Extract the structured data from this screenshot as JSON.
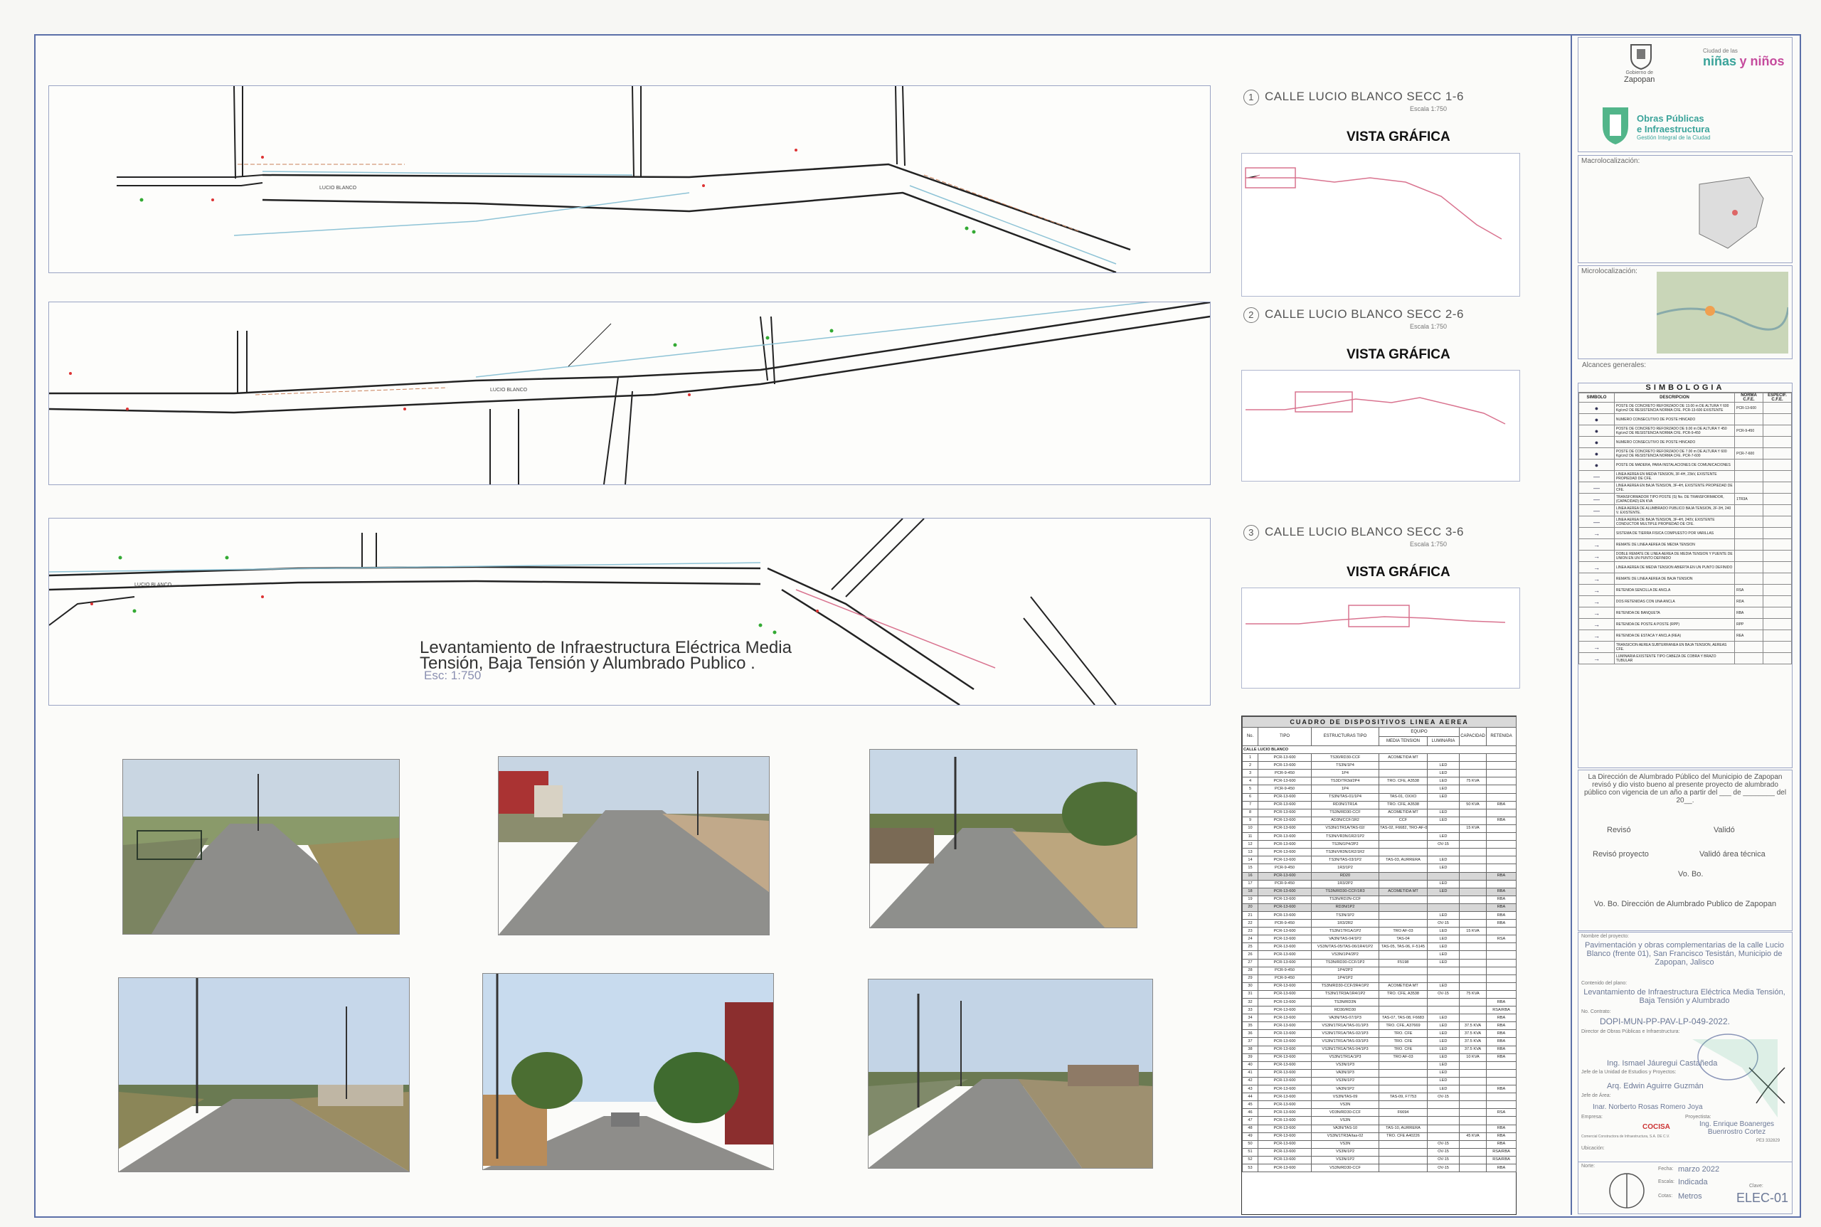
{
  "sections": [
    {
      "num": "1",
      "title": "CALLE LUCIO BLANCO SECC 1-6",
      "scale": "Escala 1:750",
      "vista": "VISTA GRÁFICA",
      "street": "LUCIO BLANCO"
    },
    {
      "num": "2",
      "title": "CALLE LUCIO BLANCO SECC 2-6",
      "scale": "Escala 1:750",
      "vista": "VISTA GRÁFICA",
      "street": "LUCIO BLANCO"
    },
    {
      "num": "3",
      "title": "CALLE LUCIO BLANCO SECC 3-6",
      "scale": "Escala 1:750",
      "vista": "VISTA GRÁFICA",
      "street": "LUCIO BLANCO"
    }
  ],
  "main_title": {
    "line1": "Levantamiento de Infraestructura Eléctrica Media",
    "line2": "Tensión, Baja Tensión y Alumbrado Publico .",
    "scale": "Esc: 1:750"
  },
  "cuadro": {
    "title": "CUADRO DE DISPOSITIVOS LINEA AEREA",
    "headers": {
      "no": "No.",
      "tipo": "TIPO",
      "estructuras": "ESTRUCTURAS TIPO",
      "equipo": "EQUIPO",
      "media": "MEDIA TENSION",
      "luminaria": "LUMINARIA",
      "capacidad": "CAPACIDAD",
      "retenida": "RETENIDA"
    },
    "group": "CALLE LUCIO BLANCO",
    "rows": [
      [
        "1",
        "PCR-13-600",
        "TS30/RD30-CCF",
        "ACOMETIDA MT",
        "",
        "",
        ""
      ],
      [
        "2",
        "PCR-13-600",
        "TS3N/1P4",
        "",
        "LED",
        "",
        ""
      ],
      [
        "3",
        "PCR-9-450",
        "1P4",
        "",
        "LED",
        "",
        ""
      ],
      [
        "4",
        "PCR-13-600",
        "TS3D/TR3d/2P4",
        "TRO. CFE, A3538",
        "LED",
        "75 KVA",
        ""
      ],
      [
        "5",
        "PCR-9-450",
        "1P4",
        "",
        "LED",
        "",
        ""
      ],
      [
        "6",
        "PCR-13-600",
        "TS3N/TAS-01/1P4",
        "TAS-01, OXXO",
        "LED",
        "",
        ""
      ],
      [
        "7",
        "PCR-13-600",
        "RD3N/1TR1A",
        "TRO. CFE, A3538",
        "",
        "50 KVA",
        "RBA"
      ],
      [
        "8",
        "PCR-13-600",
        "TS3N/RD30-CCF",
        "ACOMETIDA MT",
        "LED",
        "",
        ""
      ],
      [
        "9",
        "PCR-13-600",
        "AD3N/CCF/1R2",
        "CCF",
        "LED",
        "",
        "RBA"
      ],
      [
        "10",
        "PCR-13-600",
        "VS3N/1TR1A/TAS-02/",
        "TAS-02, F6682, TRO-AF-01",
        "",
        "15 KVA",
        ""
      ],
      [
        "11",
        "PCR-13-600",
        "TS3N/VR3N/1R2/1P2",
        "",
        "LED",
        "",
        ""
      ],
      [
        "12",
        "PCR-13-600",
        "TS3N/1P4/2P2",
        "",
        "OV-15",
        "",
        ""
      ],
      [
        "13",
        "PCR-13-600",
        "TS3N/VR3N/1R2/1R2",
        "",
        "",
        "",
        ""
      ],
      [
        "14",
        "PCR-13-600",
        "TS3N/TAS-03/1P2",
        "TAS-03, AURRERA",
        "LED",
        "",
        ""
      ],
      [
        "15",
        "PCR-9-450",
        "1R3/1P2",
        "",
        "LED",
        "",
        ""
      ],
      [
        "16",
        "PCR-13-600",
        "RD20",
        "",
        "",
        "",
        "RBA"
      ],
      [
        "17",
        "PCR-9-450",
        "1R3/2P2",
        "",
        "LED",
        "",
        ""
      ],
      [
        "18",
        "PCR-13-600",
        "TS3N/RD30-CCF/1R3",
        "ACOMETIDA MT",
        "LED",
        "",
        "RBA"
      ],
      [
        "19",
        "PCR-13-600",
        "TS3N/RD2N-CCF",
        "",
        "",
        "",
        "RBA"
      ],
      [
        "20",
        "PCR-13-600",
        "RD3N/1P2",
        "",
        "",
        "",
        "RBA"
      ],
      [
        "21",
        "PCR-13-600",
        "TS3N/1P2",
        "",
        "LED",
        "",
        "RBA"
      ],
      [
        "22",
        "PCR-9-450",
        "1R3/2R2",
        "",
        "OV-15",
        "",
        "RBA"
      ],
      [
        "23",
        "PCR-13-600",
        "TS3N/1TR1A/1P2",
        "TRO AF-03",
        "LED",
        "15 KVA",
        ""
      ],
      [
        "24",
        "PCR-13-600",
        "VA3N/TAS-04/1P2",
        "TAS-04",
        "LED",
        "",
        "RSA"
      ],
      [
        "25",
        "PCR-13-600",
        "VS3N/TAS-05/TAS-06/1R4/1P2",
        "TAS-05, TAS-06, F-5145",
        "LED",
        "",
        ""
      ],
      [
        "26",
        "PCR-13-600",
        "VS3N/1P4/2P2",
        "",
        "LED",
        "",
        ""
      ],
      [
        "27",
        "PCR-13-600",
        "TS3N/RD30-CCF/1P2",
        "F5198",
        "LED",
        "",
        ""
      ],
      [
        "28",
        "PCR-9-450",
        "1P4/2P2",
        "",
        "",
        "",
        ""
      ],
      [
        "29",
        "PCR-9-450",
        "1P4/1P2",
        "",
        "",
        "",
        ""
      ],
      [
        "30",
        "PCR-13-600",
        "TS3N/RD30-CCF/2R4/1P2",
        "ACOMETIDA MT",
        "LED",
        "",
        ""
      ],
      [
        "31",
        "PCR-13-600",
        "TS3N/1TR3A/1R4/1P2",
        "TRO. CFE, A3538",
        "OV-15",
        "75 KVA",
        ""
      ],
      [
        "32",
        "PCR-13-600",
        "TS3N/RD3N",
        "",
        "",
        "",
        "RBA"
      ],
      [
        "33",
        "PCR-13-600",
        "RD30/RD30",
        "",
        "",
        "",
        "RSA/RBA"
      ],
      [
        "34",
        "PCR-13-600",
        "VA3N/TAS-07/1P3",
        "TAS-07, TAS-08, F6683",
        "LED",
        "",
        "RBA"
      ],
      [
        "35",
        "PCR-13-600",
        "VS3N/1TR1A/TAS-01/1P3",
        "TRO. CFE, A37669",
        "LED",
        "37.5 KVA",
        "RBA"
      ],
      [
        "36",
        "PCR-13-600",
        "VS3N/1TR1A/TAS-02/1P3",
        "TRO. CFE",
        "LED",
        "37.5 KVA",
        "RBA"
      ],
      [
        "37",
        "PCR-13-600",
        "VS3N/1TR1A/TAS-03/1P3",
        "TRO. CFE",
        "LED",
        "37.5 KVA",
        "RBA"
      ],
      [
        "38",
        "PCR-13-600",
        "VS3N/1TR1A/TAS-04/1P3",
        "TRO. CFE",
        "LED",
        "37.5 KVA",
        "RBA"
      ],
      [
        "39",
        "PCR-13-600",
        "VS3N/1TR1A/1P3",
        "TRO AF-03",
        "LED",
        "10 KVA",
        "RBA"
      ],
      [
        "40",
        "PCR-13-600",
        "VS3N/1P3",
        "",
        "LED",
        "",
        ""
      ],
      [
        "41",
        "PCR-13-600",
        "VA3N/1P3",
        "",
        "LED",
        "",
        ""
      ],
      [
        "42",
        "PCR-13-600",
        "VS3N/1P2",
        "",
        "LED",
        "",
        ""
      ],
      [
        "43",
        "PCR-13-600",
        "VA3N/1P2",
        "",
        "LED",
        "",
        "RBA"
      ],
      [
        "44",
        "PCR-13-600",
        "VS3N/TAS-09",
        "TAS-09, F7753",
        "OV-15",
        "",
        ""
      ],
      [
        "45",
        "PCR-13-600",
        "VS3N",
        "",
        "",
        "",
        ""
      ],
      [
        "46",
        "PCR-13-600",
        "VD3N/RD30-CCF",
        "F6694",
        "",
        "",
        "RSA"
      ],
      [
        "47",
        "PCR-13-600",
        "VS3N",
        "",
        "",
        "",
        ""
      ],
      [
        "48",
        "PCR-13-600",
        "VA3N/TAS-10",
        "TAS-10, AURRERA",
        "",
        "",
        "RBA"
      ],
      [
        "49",
        "PCR-13-600",
        "VS3N/1TR3A/tas-02",
        "TRO. CFE A40226",
        "",
        "45 KVA",
        "RBA"
      ],
      [
        "50",
        "PCR-13-600",
        "VS3N",
        "",
        "OV-15",
        "",
        "RBA"
      ],
      [
        "51",
        "PCR-13-600",
        "VS3N/1P2",
        "",
        "OV-15",
        "",
        "RSA/RBA"
      ],
      [
        "52",
        "PCR-13-600",
        "VS3N/1P2",
        "",
        "OV-15",
        "",
        "RSA/RBA"
      ],
      [
        "53",
        "PCR-13-600",
        "VS3N/RD30-CCF",
        "",
        "OV-15",
        "",
        "RBA"
      ]
    ]
  },
  "titleblock": {
    "gov1": "Gobierno de",
    "gov2": "Zapopan",
    "ciudad": "Ciudad de las",
    "ninas": "niñas",
    "ninos": "y niños",
    "obras1": "Obras Públicas",
    "obras2": "e Infraestructura",
    "obras3": "Gestión Integral de la Ciudad",
    "macro": "Macrolocalización:",
    "micro": "Microlocalización:",
    "alcances": "Alcances generales:",
    "simbologia": "SIMBOLOGIA",
    "sym_headers": {
      "simbolo": "SIMBOLO",
      "descripcion": "DESCRIPCION",
      "norma": "NORMA C.F.E.",
      "especif": "ESPECIF. C.F.E."
    },
    "symbols": [
      {
        "desc": "POSTE DE CONCRETO REFORZADO DE 13.00 m DE ALTURA Y 600 Kg/cm2 DE RESISTENCIA NORMA CFE. PCR-13-600 EXISTENTE",
        "norma": "PCR-13-600",
        "esp": ""
      },
      {
        "desc": "NUMERO CONSECUTIVO DE POSTE HINCADO",
        "norma": "",
        "esp": ""
      },
      {
        "desc": "POSTE DE CONCRETO REFORZADO DE 9.00 m DE ALTURA Y 450 Kg/cm2 DE RESISTENCIA NORMA CFE. PCR-9-450",
        "norma": "PCR-9-450",
        "esp": ""
      },
      {
        "desc": "NUMERO CONSECUTIVO DE POSTE HINCADO",
        "norma": "",
        "esp": ""
      },
      {
        "desc": "POSTE DE CONCRETO REFORZADO DE 7.00 m DE ALTURA Y 600 Kg/cm2 DE RESISTENCIA NORMA CFE. PCR-7-600",
        "norma": "PCR-7-600",
        "esp": ""
      },
      {
        "desc": "POSTE DE MADERA, PARA INSTALACIONES DE COMUNICACIONES",
        "norma": "",
        "esp": ""
      },
      {
        "desc": "LINEA AEREA EN MEDIA TENSION, 3F-4H, 23kV, EXISTENTE PROPIEDAD DE CFE.",
        "norma": "",
        "esp": ""
      },
      {
        "desc": "LINEA AEREA EN BAJA TENSION, 3F-4H, EXISTENTE PROPIEDAD DE CFE.",
        "norma": "",
        "esp": ""
      },
      {
        "desc": "TRANSFORMADOR TIPO POSTE (S) No. DE TRANSFORMADOR, (CAPACIDAD) EN KVA",
        "norma": "1TR3A",
        "esp": ""
      },
      {
        "desc": "LINEA AEREA DE ALUMBRADO PUBLICO BAJA TENSION, 2F-3H, 240 V. EXISTENTE.",
        "norma": "",
        "esp": ""
      },
      {
        "desc": "LINEA AEREA DE BAJA TENSION, 3F-4H, 240V, EXISTENTE CONDUCTOR MULTIPLE PROPIEDAD DE CFE.",
        "norma": "",
        "esp": ""
      },
      {
        "desc": "SISTEMA DE TIERRA FISICA COMPUESTO POR VARILLAS",
        "norma": "",
        "esp": ""
      },
      {
        "desc": "REMATE DE LINEA AEREA DE MEDIA TENSION",
        "norma": "",
        "esp": ""
      },
      {
        "desc": "DOBLE REMATE DE LINEA AEREA DE MEDIA TENSION Y PUENTE DE UNION EN UN PUNTO DEFINIDO",
        "norma": "",
        "esp": ""
      },
      {
        "desc": "LINEA AEREA DE MEDIA TENSION ABIERTA EN UN PUNTO DEFINIDO",
        "norma": "",
        "esp": ""
      },
      {
        "desc": "REMATE DE LINEA AEREA DE BAJA TENSION",
        "norma": "",
        "esp": ""
      },
      {
        "desc": "RETENIDA SENCILLA DE ANCLA",
        "norma": "RSA",
        "esp": ""
      },
      {
        "desc": "DOS RETENIDAS CON UNA ANCLA",
        "norma": "RDA",
        "esp": ""
      },
      {
        "desc": "RETENIDA DE BANQUETA",
        "norma": "RBA",
        "esp": ""
      },
      {
        "desc": "RETENIDA DE POSTE A POSTE (RPP)",
        "norma": "RPP",
        "esp": ""
      },
      {
        "desc": "RETENIDA DE ESTACA Y ANCLA (REA)",
        "norma": "REA",
        "esp": ""
      },
      {
        "desc": "TRANSICION AEREA SUBTERRANEA EN BAJA TENSION, AEREAS CFE.",
        "norma": "",
        "esp": ""
      },
      {
        "desc": "LUMINARIA EXISTENTE TIPO CABEZA DE COBRA Y BRAZO TUBULAR",
        "norma": "",
        "esp": ""
      }
    ],
    "direccion": "La Dirección de Alumbrado Público del Municipio de Zapopan revisó y dio visto bueno al presente proyecto de alumbrado público con vigencia de un año a partir del ___ de ________ del 20__.",
    "reviso": "Revisó",
    "valido": "Validó",
    "reviso_proy": "Revisó proyecto",
    "valido_area": "Validó área técnica",
    "vobo": "Vo. Bo.",
    "vobo_dir": "Vo. Bo. Dirección de Alumbrado Publico de Zapopan",
    "nombre_label": "Nombre del proyecto:",
    "nombre": "Pavimentación y obras complementarias de la calle Lucio Blanco (frente 01), San Francisco Tesistán, Municipio de Zapopan, Jalisco",
    "contenido_label": "Contenido del plano:",
    "contenido": "Levantamiento de Infraestructura Eléctrica Media Tensión, Baja Tensión y Alumbrado",
    "contrato": "DOPI-MUN-PP-PAV-LP-049-2022.",
    "contrato_label": "No. Contrato:",
    "director_label": "Director de Obras Públicas e Infraestructura:",
    "director": "Ing. Ismael Jáuregui Castañeda",
    "jefe_label": "Jefe de la Unidad de Estudios y Proyectos:",
    "jefe": "Arq. Edwin Aguirre Guzmán",
    "jefe_area_label": "Jefe de Área:",
    "jefe_area": "Inar. Norberto Rosas Romero Joya",
    "empresa_label": "Empresa:",
    "proyectista_label": "Proyectista:",
    "empresa": "COCISA",
    "empresa_desc": "Comercial Constructora de Infraestructura, S.A. DE C.V.",
    "proyectista": "Ing. Enrique Boanerges Buenrostro Cortez",
    "proyectista_id": "PE3 332829",
    "ubicacion": "Ubicación:",
    "norte": "Norte:",
    "fecha_label": "Fecha:",
    "fecha": "marzo 2022",
    "escala_label": "Escala:",
    "escala": "Indicada",
    "cotas_label": "Cotas:",
    "cotas": "Metros",
    "clave_label": "Clave:",
    "clave": "ELEC-01"
  },
  "colors": {
    "border": "#5b6fa8",
    "profile": "#d9738f",
    "mt": "#8ec3d6",
    "road": "#222222",
    "green": "#3aa39a"
  }
}
